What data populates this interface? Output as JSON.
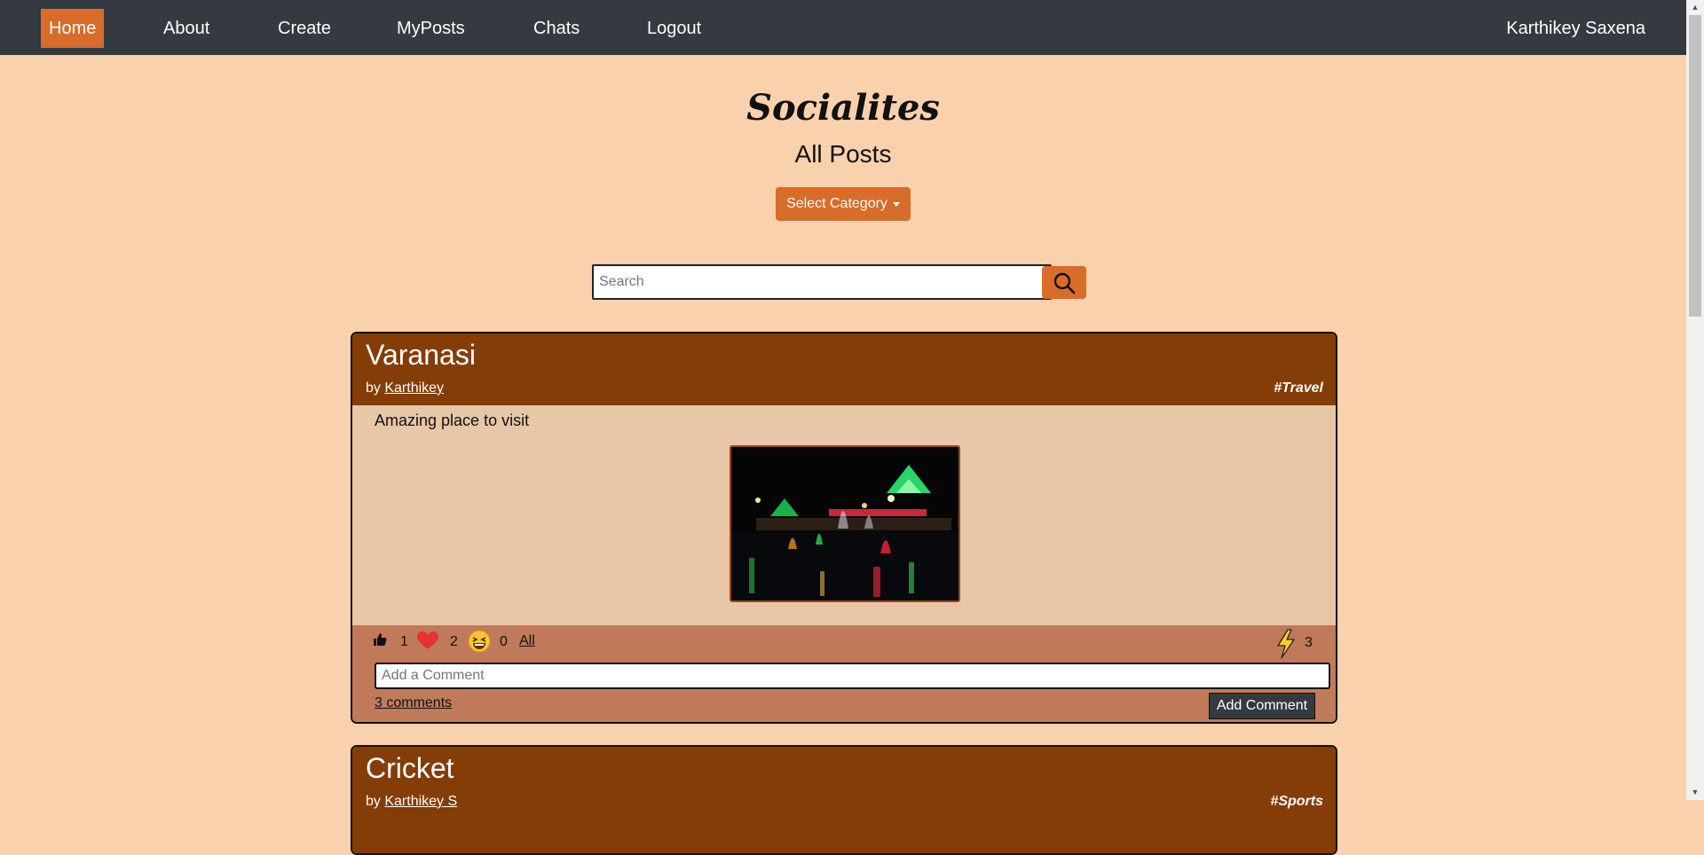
{
  "navbar": {
    "items": [
      {
        "label": "Home",
        "active": true
      },
      {
        "label": "About"
      },
      {
        "label": "Create"
      },
      {
        "label": "MyPosts"
      },
      {
        "label": "Chats"
      },
      {
        "label": "Logout"
      }
    ],
    "user": "Karthikey Saxena"
  },
  "page": {
    "brand": "Socialites",
    "subtitle": "All Posts",
    "category_button": "Select Category"
  },
  "search": {
    "placeholder": "Search",
    "value": "",
    "icon": "search-icon"
  },
  "posts": [
    {
      "title": "Varanasi",
      "by_prefix": "by",
      "author": "Karthikey",
      "tag": "#Travel",
      "description": "Amazing place to visit",
      "reactions": {
        "like": "1",
        "love": "2",
        "laugh": "0",
        "all_label": "All"
      },
      "power_count": "3",
      "comment_placeholder": "Add a Comment",
      "comments_link": "3 comments",
      "add_comment_label": "Add Comment"
    },
    {
      "title": "Cricket",
      "by_prefix": "by",
      "author": "Karthikey S",
      "tag": "#Sports"
    }
  ],
  "colors": {
    "navbar": "#343a40",
    "accent": "#d86c2a",
    "background": "#fad1ad",
    "card_header": "#843d06",
    "card_body": "#e8c6a8",
    "card_footer": "#c07a5a"
  }
}
